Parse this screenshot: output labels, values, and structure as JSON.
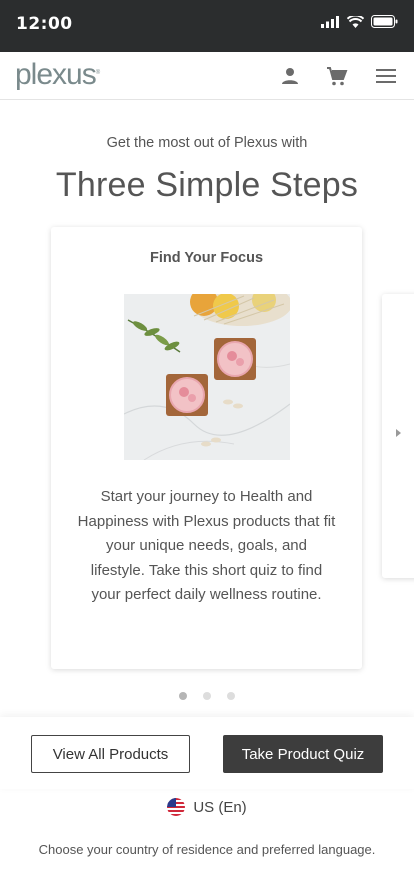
{
  "status_bar": {
    "time": "12:00"
  },
  "header": {
    "logo_text": "plexus",
    "icons": [
      "user-icon",
      "cart-icon",
      "menu-icon"
    ]
  },
  "hero": {
    "intro": "Get the most out of Plexus with",
    "headline": "Three Simple Steps"
  },
  "carousel": {
    "active_index": 0,
    "slide_count": 3,
    "slides": [
      {
        "title": "Find Your Focus",
        "body": "Start your journey to Health and Happiness with Plexus products that fit your unique needs, goals, and lifestyle. Take this short quiz to find your perfect daily wellness routine."
      }
    ]
  },
  "actions": {
    "view_all": "View All Products",
    "take_quiz": "Take Product Quiz"
  },
  "locale": {
    "current": "US (En)",
    "note": "Choose your country of residence and preferred language."
  },
  "colors": {
    "dark": "#3d3d3d",
    "logo": "#7a8a8c",
    "text": "#555555"
  }
}
